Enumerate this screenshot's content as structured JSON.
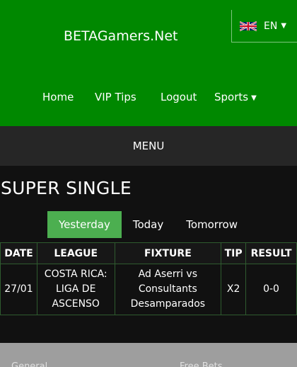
{
  "site": {
    "title": "BETAGamers.Net"
  },
  "language": {
    "code": "EN",
    "flag_icon": "uk-flag-icon"
  },
  "nav": {
    "items": [
      {
        "label": "Home"
      },
      {
        "label": "VIP Tips"
      },
      {
        "label": "Logout"
      },
      {
        "label": "Sports"
      }
    ]
  },
  "menu": {
    "label": "MENU"
  },
  "page": {
    "title": "SUPER SINGLE"
  },
  "tabs": [
    {
      "label": "Yesterday",
      "active": true
    },
    {
      "label": "Today",
      "active": false
    },
    {
      "label": "Tomorrow",
      "active": false
    }
  ],
  "table": {
    "headers": [
      "DATE",
      "LEAGUE",
      "FIXTURE",
      "TIP",
      "RESULT"
    ],
    "rows": [
      {
        "date": "27/01",
        "league": "COSTA RICA: LIGA DE ASCENSO",
        "fixture": "Ad Aserri vs Consultants Desamparados",
        "tip": "X2",
        "result": "0-0"
      }
    ]
  },
  "footer": {
    "links": [
      "General",
      "Free Bets"
    ]
  },
  "colors": {
    "header_green": "#008800",
    "active_tab": "#4caf50",
    "menu_bar": "#262626",
    "background": "#111111"
  }
}
